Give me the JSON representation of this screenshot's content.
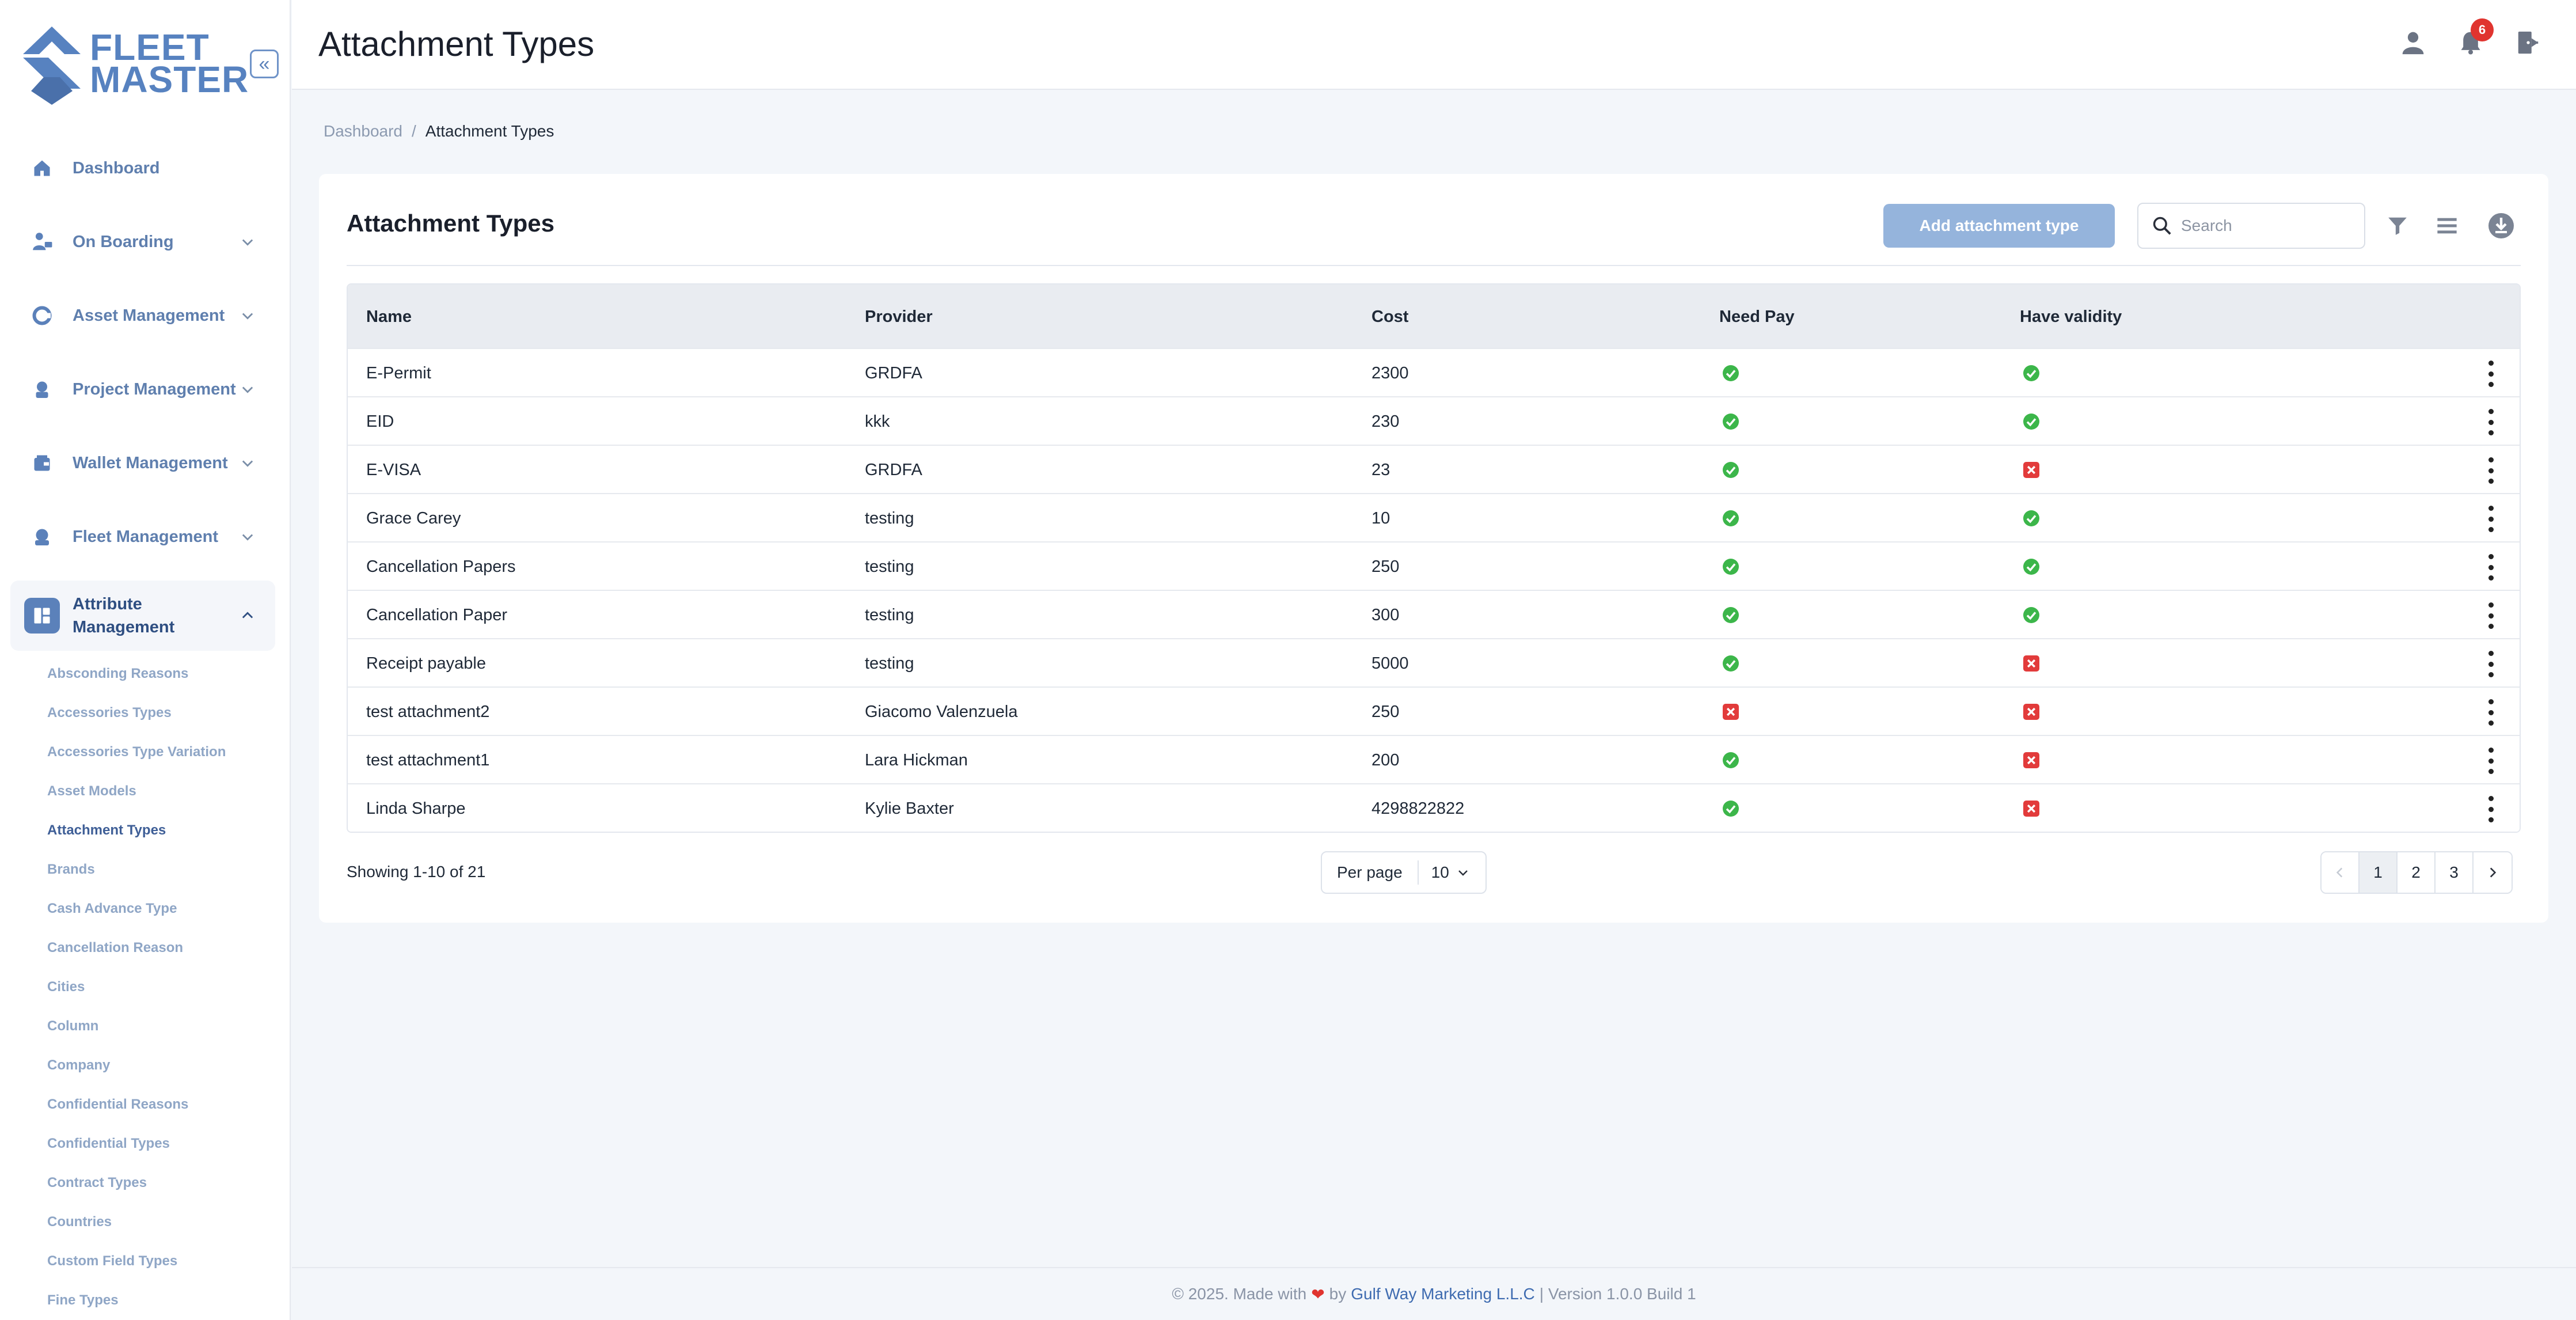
{
  "brand": {
    "name_line1": "FLEET",
    "name_line2": "MASTER"
  },
  "sidebar": {
    "items": [
      {
        "label": "Dashboard",
        "icon": "home-icon"
      },
      {
        "label": "On Boarding",
        "icon": "onboarding-icon"
      },
      {
        "label": "Asset Management",
        "icon": "asset-icon"
      },
      {
        "label": "Project Management",
        "icon": "project-icon"
      },
      {
        "label": "Wallet Management",
        "icon": "wallet-icon"
      },
      {
        "label": "Fleet Management",
        "icon": "fleet-icon"
      },
      {
        "label": "Attribute Management",
        "icon": "attribute-icon"
      }
    ],
    "subitems": [
      "Absconding Reasons",
      "Accessories Types",
      "Accessories Type Variation",
      "Asset Models",
      "Attachment Types",
      "Brands",
      "Cash Advance Type",
      "Cancellation Reason",
      "Cities",
      "Column",
      "Company",
      "Confidential Reasons",
      "Confidential Types",
      "Contract Types",
      "Countries",
      "Custom Field Types",
      "Fine Types"
    ],
    "active_subitem": "Attachment Types"
  },
  "header": {
    "title": "Attachment Types",
    "notification_count": "6"
  },
  "breadcrumb": {
    "home": "Dashboard",
    "separator": "/",
    "current": "Attachment Types"
  },
  "card": {
    "title": "Attachment Types",
    "add_button": "Add attachment type",
    "search_placeholder": "Search"
  },
  "table": {
    "columns": [
      "Name",
      "Provider",
      "Cost",
      "Need Pay",
      "Have validity"
    ],
    "rows": [
      {
        "name": "E-Permit",
        "provider": "GRDFA",
        "cost": "2300",
        "need_pay": true,
        "have_validity": true
      },
      {
        "name": "EID",
        "provider": "kkk",
        "cost": "230",
        "need_pay": true,
        "have_validity": true
      },
      {
        "name": "E-VISA",
        "provider": "GRDFA",
        "cost": "23",
        "need_pay": true,
        "have_validity": false
      },
      {
        "name": "Grace Carey",
        "provider": "testing",
        "cost": "10",
        "need_pay": true,
        "have_validity": true
      },
      {
        "name": "Cancellation Papers",
        "provider": "testing",
        "cost": "250",
        "need_pay": true,
        "have_validity": true
      },
      {
        "name": "Cancellation Paper",
        "provider": "testing",
        "cost": "300",
        "need_pay": true,
        "have_validity": true
      },
      {
        "name": "Receipt payable",
        "provider": "testing",
        "cost": "5000",
        "need_pay": true,
        "have_validity": false
      },
      {
        "name": "test attachment2",
        "provider": "Giacomo Valenzuela",
        "cost": "250",
        "need_pay": false,
        "have_validity": false
      },
      {
        "name": "test attachment1",
        "provider": "Lara Hickman",
        "cost": "200",
        "need_pay": true,
        "have_validity": false
      },
      {
        "name": "Linda Sharpe",
        "provider": "Kylie Baxter",
        "cost": "4298822822",
        "need_pay": true,
        "have_validity": false
      }
    ]
  },
  "pagination": {
    "showing": "Showing 1-10 of 21",
    "per_page_label": "Per page",
    "per_page_value": "10",
    "pages": [
      "1",
      "2",
      "3"
    ],
    "current_page": "1"
  },
  "footer": {
    "prefix": "© 2025. Made with",
    "by": "by",
    "company": "Gulf Way Marketing L.L.C",
    "version": "| Version 1.0.0 Build 1"
  },
  "colors": {
    "accent": "#5b81ba",
    "success": "#3cb64a",
    "danger": "#e23b3b",
    "badge": "#e0342f"
  }
}
